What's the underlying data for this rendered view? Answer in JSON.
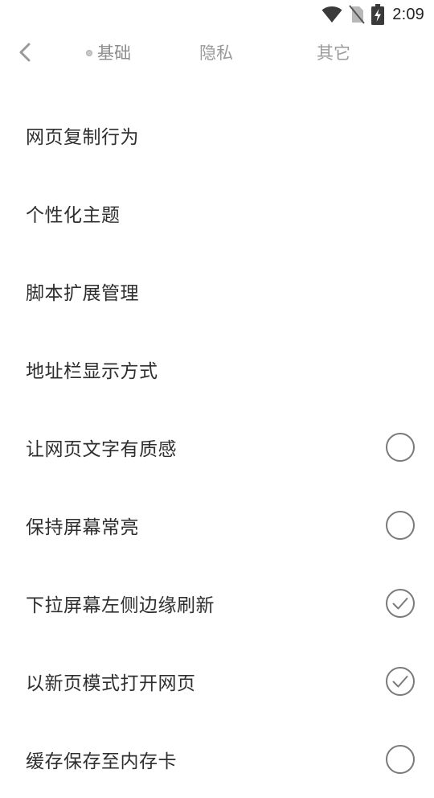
{
  "status_bar": {
    "time": "2:09",
    "icons": [
      "wifi-icon",
      "no-sim-icon",
      "battery-charging-icon"
    ]
  },
  "header": {
    "back_icon": "chevron-left-icon",
    "tabs": [
      {
        "label": "基础",
        "active": true
      },
      {
        "label": "隐私",
        "active": false
      },
      {
        "label": "其它",
        "active": false
      }
    ]
  },
  "settings": [
    {
      "label": "网页复制行为",
      "has_toggle": false
    },
    {
      "label": "个性化主题",
      "has_toggle": false
    },
    {
      "label": "脚本扩展管理",
      "has_toggle": false
    },
    {
      "label": "地址栏显示方式",
      "has_toggle": false
    },
    {
      "label": "让网页文字有质感",
      "has_toggle": true,
      "checked": false
    },
    {
      "label": "保持屏幕常亮",
      "has_toggle": true,
      "checked": false
    },
    {
      "label": "下拉屏幕左侧边缘刷新",
      "has_toggle": true,
      "checked": true
    },
    {
      "label": "以新页模式打开网页",
      "has_toggle": true,
      "checked": true
    },
    {
      "label": "缓存保存至内存卡",
      "has_toggle": true,
      "checked": false
    }
  ],
  "colors": {
    "text": "#2e2e2e",
    "tab_inactive": "#9a9a9a",
    "toggle_stroke": "#7a7a7a",
    "background": "#ffffff"
  }
}
